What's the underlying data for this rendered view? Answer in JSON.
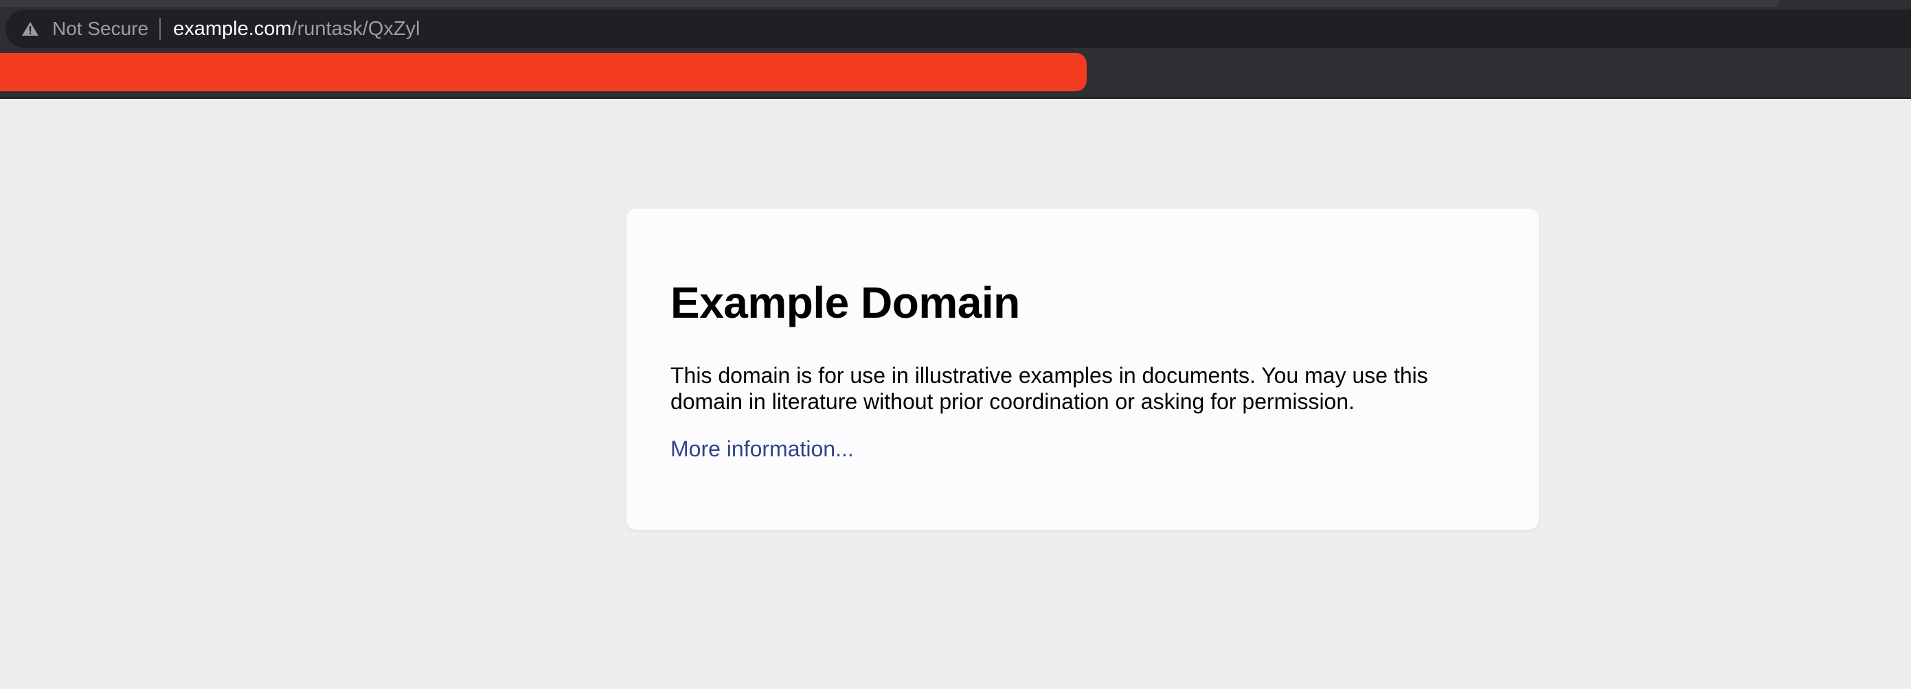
{
  "browser": {
    "security_label": "Not Secure",
    "url_host": "example.com",
    "url_path": "/runtask/QxZyl",
    "redaction_color": "#f33c20"
  },
  "page": {
    "title": "Example Domain",
    "description": "This domain is for use in illustrative examples in documents. You may use this domain in literature without prior coordination or asking for permission.",
    "link_text": "More information...",
    "link_color": "#334488"
  }
}
